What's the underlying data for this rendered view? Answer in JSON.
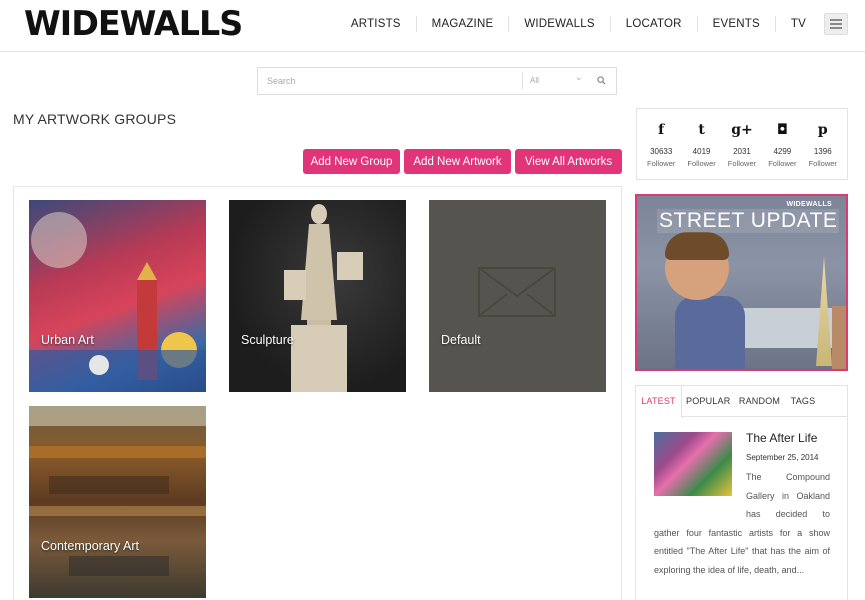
{
  "header": {
    "logo": "WIDEWALLS",
    "nav": [
      "ARTISTS",
      "MAGAZINE",
      "WIDEWALLS",
      "LOCATOR",
      "EVENTS",
      "TV"
    ]
  },
  "search": {
    "placeholder": "Search",
    "category": "All"
  },
  "main": {
    "title": "MY ARTWORK GROUPS",
    "buttons": {
      "add_group": "Add New Group",
      "add_artwork": "Add New Artwork",
      "view_all": "View All Artworks"
    },
    "groups": [
      {
        "label": "Urban Art"
      },
      {
        "label": "Sculpture"
      },
      {
        "label": "Default"
      },
      {
        "label": "Contemporary Art"
      }
    ]
  },
  "sidebar": {
    "social": [
      {
        "icon": "facebook-icon",
        "glyph": "f",
        "count": "30633",
        "label": "Follower"
      },
      {
        "icon": "twitter-icon",
        "glyph": "t",
        "count": "4019",
        "label": "Follower"
      },
      {
        "icon": "google-plus-icon",
        "glyph": "g+",
        "count": "2031",
        "label": "Follower"
      },
      {
        "icon": "instagram-icon",
        "glyph": "◘",
        "count": "4299",
        "label": "Follower"
      },
      {
        "icon": "pinterest-icon",
        "glyph": "p",
        "count": "1396",
        "label": "Follower"
      }
    ],
    "banner": {
      "brand": "WIDEWALLS",
      "title": "STREET UPDATE"
    },
    "tabs": [
      "LATEST",
      "POPULAR",
      "RANDOM",
      "TAGS"
    ],
    "post": {
      "title": "The After Life",
      "date": "September 25, 2014",
      "excerpt": "The Compound Gallery in Oakland has decided to gather four fantastic artists for a show entitled \"The After Life\" that has the aim of exploring the idea of life, death, and..."
    }
  },
  "colors": {
    "accent": "#e23579",
    "banner_border": "#d93b74"
  }
}
